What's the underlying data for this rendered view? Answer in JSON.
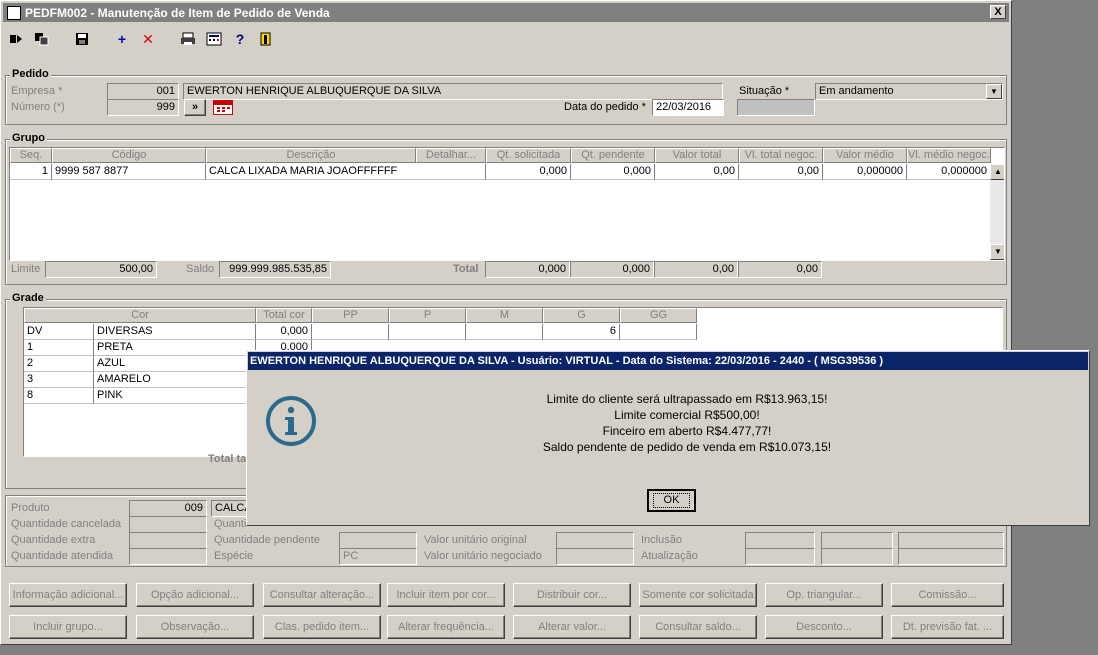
{
  "window": {
    "title": "PEDFM002 - Manutenção de Item de Pedido de Venda",
    "close": "X"
  },
  "pedido": {
    "legend": "Pedido",
    "empresa_label": "Empresa *",
    "empresa_code": "001",
    "empresa_name": "EWERTON HENRIQUE ALBUQUERQUE DA SILVA",
    "numero_label": "Número (*)",
    "numero": "999",
    "nav_btn": "»",
    "data_label": "Data do pedido *",
    "data": "22/03/2016",
    "situacao_label": "Situação *",
    "situacao": "Em andamento"
  },
  "grupo": {
    "legend": "Grupo",
    "headers": [
      "Seq.",
      "Código",
      "Descrição",
      "Detalhar...",
      "Qt. solicitada",
      "Qt. pendente",
      "Valor total",
      "Vl. total negoc.",
      "Valor médio",
      "Vl. médio negoc."
    ],
    "rows": [
      [
        "1",
        "9999 587 8877",
        "CALCA LIXADA MARIA JOAOFFFFFF",
        "",
        "0,000",
        "0,000",
        "0,00",
        "0,00",
        "0,000000",
        "0,000000"
      ]
    ],
    "limite_label": "Limite",
    "limite": "500,00",
    "saldo_label": "Saldo",
    "saldo": "999.999.985.535,85",
    "total_label": "Total",
    "totals": [
      "0,000",
      "0,000",
      "0,00",
      "0,00"
    ]
  },
  "grade": {
    "legend": "Grade",
    "headers": [
      "Cor",
      "Total cor",
      "PP",
      "P",
      "M",
      "G",
      "GG"
    ],
    "rows": [
      [
        "DV",
        "DIVERSAS",
        "0,000",
        "",
        "",
        "",
        "6",
        ""
      ],
      [
        "1",
        "PRETA",
        "0,000",
        "",
        "",
        "",
        "",
        ""
      ],
      [
        "2",
        "AZUL",
        "",
        "",
        "",
        "",
        "",
        ""
      ],
      [
        "3",
        "AMARELO",
        "",
        "",
        "",
        "",
        "",
        ""
      ],
      [
        "8",
        "PINK",
        "",
        "",
        "",
        "",
        "",
        ""
      ]
    ],
    "total_label": "Total ta"
  },
  "produto": {
    "produto_label": "Produto",
    "produto_code": "009",
    "produto_name": "CALCA",
    "qc_label": "Quantidade cancelada",
    "qe_label": "Quantidade extra",
    "qa_label": "Quantidade atendida",
    "quant_label": "Quanti",
    "qp_label": "Quantidade pendente",
    "esp_label": "Espécie",
    "esp": "PC",
    "vuo_label": "Valor unitário original",
    "vun_label": "Valor unitário negociado",
    "incl_label": "Inclusão",
    "atual_label": "Atualização"
  },
  "buttons_row1": [
    "Informação adicional...",
    "Opção adicional...",
    "Consultar alteração...",
    "Incluir item por cor...",
    "Distribuir cor...",
    "Somente cor solicitada",
    "Op. triangular...",
    "Comissão..."
  ],
  "buttons_row2": [
    "Incluir grupo...",
    "Observação...",
    "Clas. pedido item...",
    "Alterar frequência...",
    "Alterar valor...",
    "Consultar saldo...",
    "Desconto...",
    "Dt. previsão fat. ..."
  ],
  "dialog": {
    "title": "EWERTON HENRIQUE ALBUQUERQUE DA SILVA - Usuário: VIRTUAL - Data do Sistema: 22/03/2016 - 2440 - ( MSG39536 )",
    "lines": [
      "Limite do cliente será ultrapassado em R$13.963,15!",
      "Limite comercial R$500,00!",
      "Finceiro em aberto R$4.477,77!",
      "Saldo pendente de pedido de venda em R$10.073,15!"
    ],
    "ok": "OK"
  }
}
